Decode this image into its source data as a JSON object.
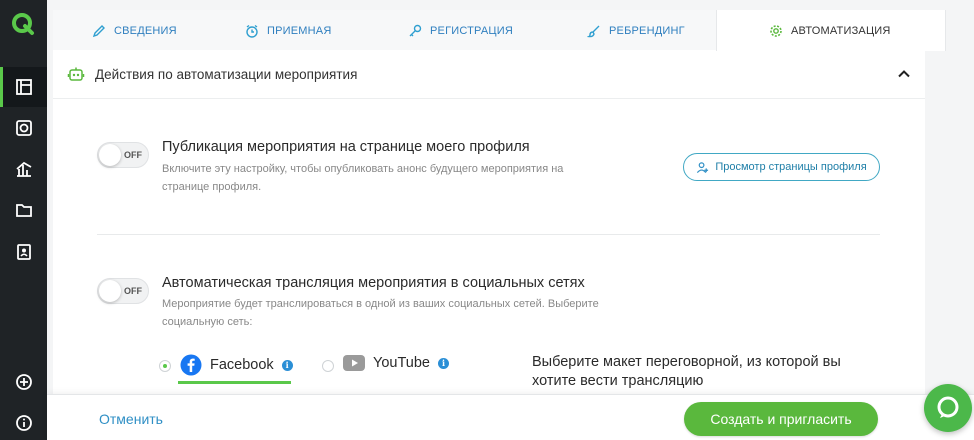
{
  "tabs": [
    {
      "label": "СВЕДЕНИЯ",
      "icon": "pencil-icon"
    },
    {
      "label": "ПРИЕМНАЯ",
      "icon": "alarm-clock-icon"
    },
    {
      "label": "РЕГИСТРАЦИЯ",
      "icon": "key-icon"
    },
    {
      "label": "РЕБРЕНДИНГ",
      "icon": "brush-icon"
    },
    {
      "label": "АВТОМАТИЗАЦИЯ",
      "icon": "gear-icon"
    }
  ],
  "active_tab": "АВТОМАТИЗАЦИЯ",
  "section": {
    "title": "Действия по автоматизации мероприятия"
  },
  "options": [
    {
      "title": "Публикация мероприятия на странице моего профиля",
      "desc": "Включите эту настройку, чтобы опубликовать анонс будущего мероприятия на странице профиля.",
      "toggle": "OFF",
      "button": "Просмотр страницы профиля"
    },
    {
      "title": "Автоматическая трансляция мероприятия в социальных сетях",
      "desc": "Мероприятие будет транслироваться в одной из ваших социальных сетей. Выберите социальную сеть:",
      "toggle": "OFF"
    }
  ],
  "social": {
    "facebook": "Facebook",
    "youtube": "YouTube",
    "info": "i",
    "selected": "Facebook",
    "room_prompt": "Выберите макет переговорной, из которой вы хотите вести трансляцию"
  },
  "footer": {
    "cancel": "Отменить",
    "submit": "Создать и пригласить"
  },
  "colors": {
    "accent_green": "#5ab83d",
    "link_blue": "#2f8fc5",
    "sidebar": "#1f2326"
  }
}
